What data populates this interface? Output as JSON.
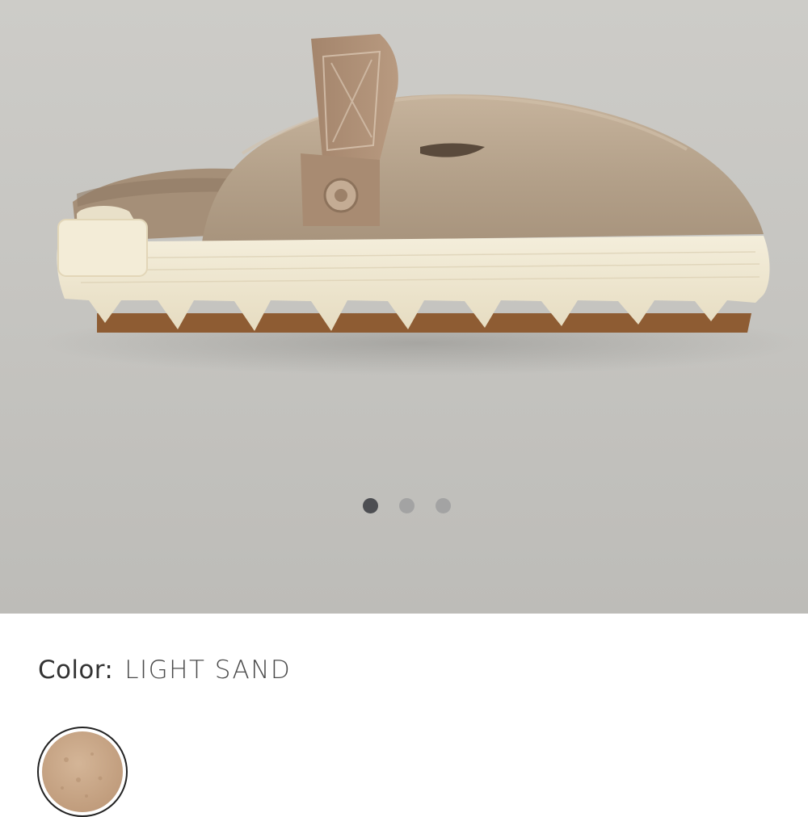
{
  "gallery": {
    "image_alt": "Light sand suede clog with strap and cream lug sole",
    "dot_count": 3,
    "active_index": 0
  },
  "color": {
    "label": "Color:",
    "value": "LIGHT SAND",
    "swatch_color": "#c9a98b"
  },
  "colors": {
    "dot_active": "#4d4e52",
    "dot_inactive": "#a3a3a3",
    "suede": "#b6a38d",
    "sole": "#efe8d2"
  }
}
